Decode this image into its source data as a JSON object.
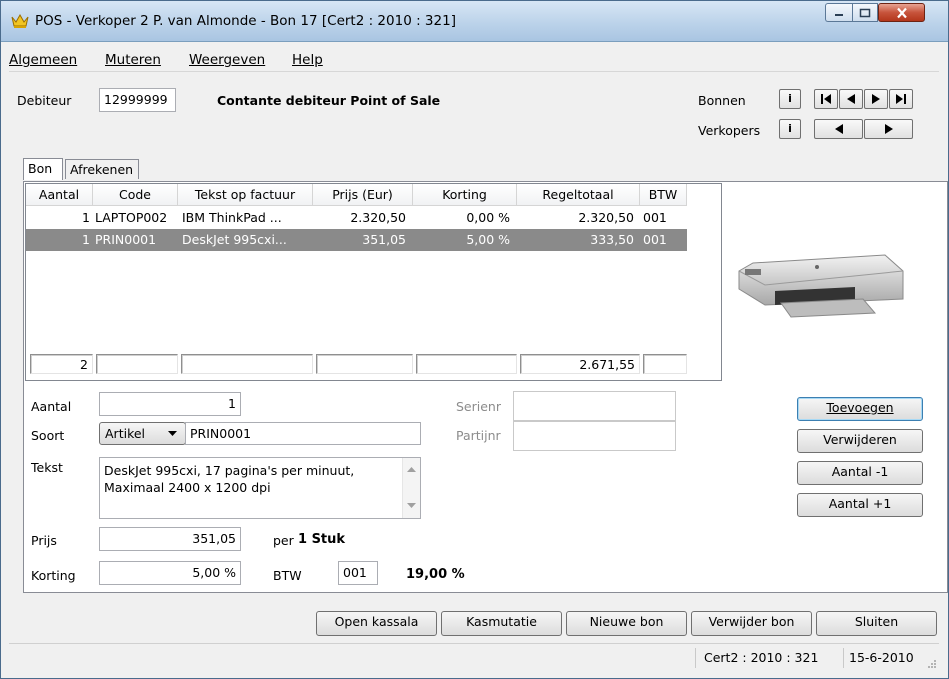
{
  "window": {
    "title": "POS - Verkoper 2 P. van Almonde - Bon 17  [Cert2 : 2010 : 321]"
  },
  "menu": [
    "Algemeen",
    "Muteren",
    "Weergeven",
    "Help"
  ],
  "header": {
    "debiteur_label": "Debiteur",
    "debiteur_value": "12999999",
    "debiteur_name": "Contante debiteur Point of Sale",
    "bonnen_label": "Bonnen",
    "verkopers_label": "Verkopers",
    "info_label": "i"
  },
  "tabs": [
    {
      "label": "Bon",
      "active": true
    },
    {
      "label": "Afrekenen",
      "active": false
    }
  ],
  "grid": {
    "columns": [
      "Aantal",
      "Code",
      "Tekst op factuur",
      "Prijs (Eur)",
      "Korting",
      "Regeltotaal",
      "BTW"
    ],
    "rows": [
      {
        "aantal": "1",
        "code": "LAPTOP002",
        "tekst": "IBM ThinkPad ...",
        "prijs": "2.320,50",
        "korting": "0,00 %",
        "regeltotaal": "2.320,50",
        "btw": "001",
        "selected": false
      },
      {
        "aantal": "1",
        "code": "PRIN0001",
        "tekst": "DeskJet 995cxi...",
        "prijs": "351,05",
        "korting": "5,00 %",
        "regeltotaal": "333,50",
        "btw": "001",
        "selected": true
      }
    ],
    "totals": {
      "aantal": "2",
      "regeltotaal": "2.671,55"
    }
  },
  "form": {
    "aantal_label": "Aantal",
    "aantal_value": "1",
    "soort_label": "Soort",
    "soort_select": "Artikel",
    "soort_code": "PRIN0001",
    "tekst_label": "Tekst",
    "tekst_value": "DeskJet 995cxi, 17 pagina's per minuut, Maximaal 2400 x 1200 dpi",
    "prijs_label": "Prijs",
    "prijs_value": "351,05",
    "per_label": "per",
    "per_unit": "1 Stuk",
    "korting_label": "Korting",
    "korting_value": "5,00 %",
    "btw_label": "BTW",
    "btw_code": "001",
    "btw_pct": "19,00 %",
    "serienr_label": "Serienr",
    "serienr_value": "",
    "partijnr_label": "Partijnr",
    "partijnr_value": ""
  },
  "side_buttons": [
    "Toevoegen",
    "Verwijderen",
    "Aantal -1",
    "Aantal +1"
  ],
  "bottom_buttons": [
    "Open kassala",
    "Kasmutatie",
    "Nieuwe bon",
    "Verwijder bon",
    "Sluiten"
  ],
  "status": {
    "cert": "Cert2 : 2010 : 321",
    "date": "15-6-2010"
  },
  "icons": {
    "app": "crown-icon",
    "first": "first-record-icon",
    "prev": "previous-icon",
    "next": "next-icon",
    "last": "last-record-icon"
  }
}
